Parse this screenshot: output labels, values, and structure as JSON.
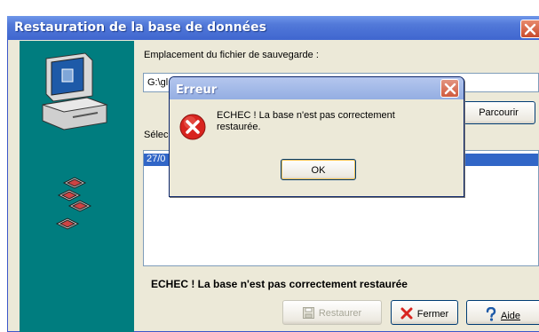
{
  "window": {
    "title": "Restauration de la base de données",
    "close_icon": "close-icon"
  },
  "form": {
    "path_label": "Emplacement du fichier de sauvegarde :",
    "path_value": "G:\\gl",
    "browse_label": "Parcourir",
    "select_label": "Sélec",
    "list_rows": [
      "27/0"
    ]
  },
  "status_text": "ECHEC ! La base n'est pas correctement restaurée",
  "buttons": {
    "restore_label": "Restaurer",
    "close_label": "Fermer",
    "help_label": "Aide"
  },
  "dialog": {
    "title": "Erreur",
    "message_line1": "ECHEC ! La base n'est pas correctement",
    "message_line2": "restaurée.",
    "ok_label": "OK",
    "icon": "error-icon"
  },
  "colors": {
    "sidebar": "#007d7f",
    "titlebar": "#3f66cf",
    "selection": "#3166c7",
    "error": "#d8241f"
  }
}
